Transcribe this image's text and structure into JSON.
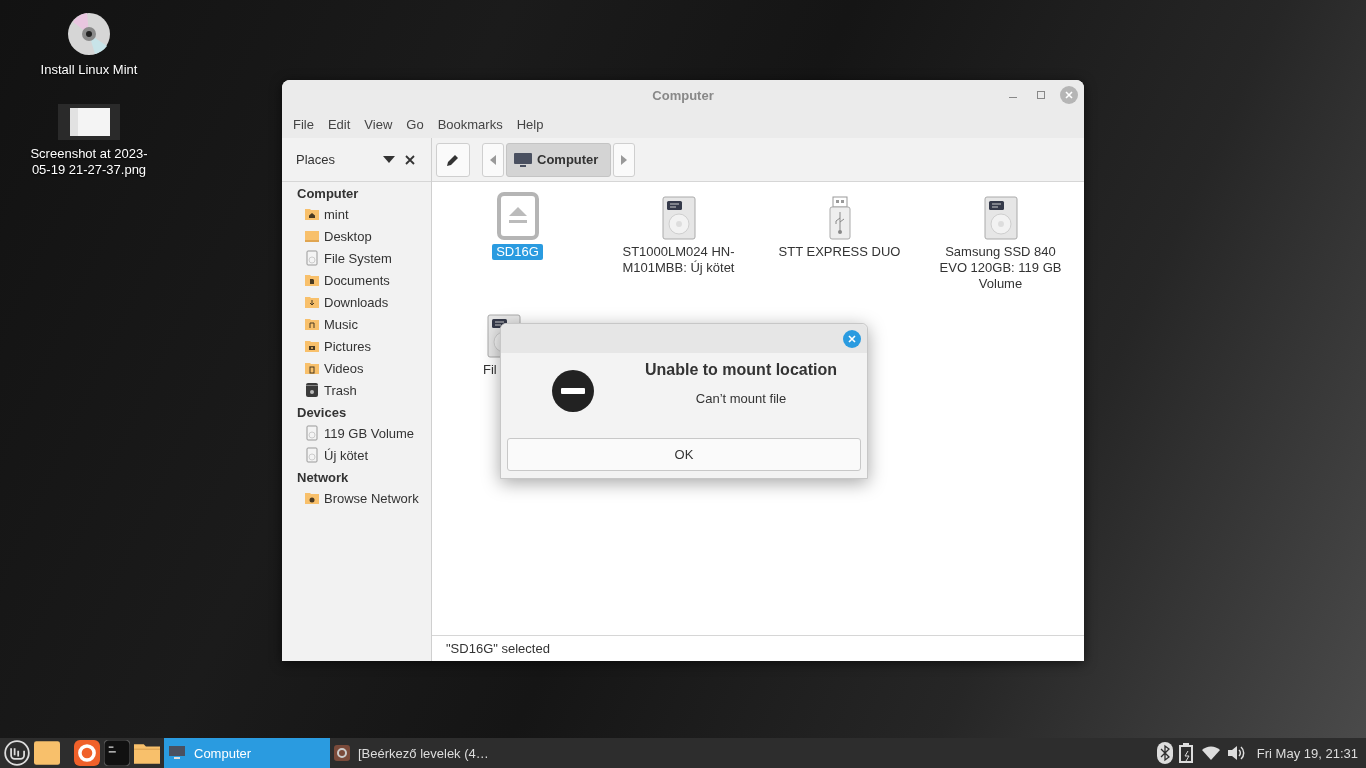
{
  "desktop_icons": [
    {
      "label": "Install Linux Mint",
      "kind": "disc"
    },
    {
      "label": "Screenshot at 2023-05-19 21-27-37.png",
      "kind": "image"
    }
  ],
  "window": {
    "title": "Computer",
    "menu": [
      "File",
      "Edit",
      "View",
      "Go",
      "Bookmarks",
      "Help"
    ],
    "sidebar": {
      "title": "Places",
      "sections": [
        {
          "heading": "Computer",
          "items": [
            {
              "label": "mint",
              "kind": "home"
            },
            {
              "label": "Desktop",
              "kind": "desktop"
            },
            {
              "label": "File System",
              "kind": "drive"
            },
            {
              "label": "Documents",
              "kind": "documents"
            },
            {
              "label": "Downloads",
              "kind": "downloads"
            },
            {
              "label": "Music",
              "kind": "music"
            },
            {
              "label": "Pictures",
              "kind": "pictures"
            },
            {
              "label": "Videos",
              "kind": "videos"
            },
            {
              "label": "Trash",
              "kind": "trash"
            }
          ]
        },
        {
          "heading": "Devices",
          "items": [
            {
              "label": "119 GB Volume",
              "kind": "drive"
            },
            {
              "label": "Új kötet",
              "kind": "drive"
            }
          ]
        },
        {
          "heading": "Network",
          "items": [
            {
              "label": "Browse Network",
              "kind": "network"
            }
          ]
        }
      ]
    },
    "path": [
      {
        "label": "Computer",
        "selected": true
      }
    ],
    "items": [
      {
        "label": "SD16G",
        "kind": "sd",
        "selected": true,
        "clipped": false
      },
      {
        "label": "ST1000LM024 HN-M101MBB: Új kötet",
        "kind": "hdd",
        "selected": false,
        "clipped": false
      },
      {
        "label": "STT EXPRESS DUO",
        "kind": "usb",
        "selected": false,
        "clipped": false
      },
      {
        "label": "Samsung SSD 840 EVO 120GB: 119 GB Volume",
        "kind": "hdd",
        "selected": false,
        "clipped": false
      },
      {
        "label": "Fil",
        "kind": "hdd",
        "selected": false,
        "clipped": true
      }
    ],
    "status_bar": "\"SD16G\" selected"
  },
  "dialog": {
    "title": "Unable to mount location",
    "message": "Can’t mount file",
    "button": "OK"
  },
  "taskbar": {
    "windows": [
      {
        "label": "Computer",
        "kind": "computer",
        "selected": true
      },
      {
        "label": "[Beérkező levelek (4…",
        "kind": "mail",
        "selected": false
      }
    ],
    "clock": "Fri May 19, 21:31"
  }
}
